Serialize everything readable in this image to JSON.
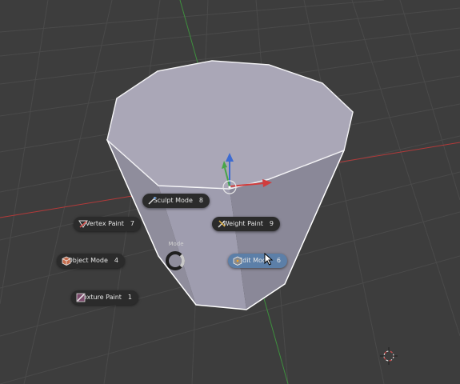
{
  "viewport": {
    "background_color": "#3d3d3d",
    "grid_color": "#4a4a4a",
    "x_axis_color": "#b23a3a",
    "y_axis_color": "#3e8f3e"
  },
  "object": {
    "name": "cylinder",
    "face_color": "#a8a4b2",
    "outline_color": "#ffffff",
    "side_color_light": "#9896a6",
    "side_color_dark": "#7c7b8a"
  },
  "pie_menu": {
    "center_label": "Mode",
    "items": [
      {
        "id": "sculpt",
        "label": "Sculpt Mode",
        "shortcut": "8",
        "icon": "sculpt-brush-icon",
        "active": false
      },
      {
        "id": "vertex-paint",
        "label": "Vertex Paint",
        "shortcut": "7",
        "icon": "vertex-paint-icon",
        "active": false
      },
      {
        "id": "weight-paint",
        "label": "Weight Paint",
        "shortcut": "9",
        "icon": "weight-paint-icon",
        "active": false
      },
      {
        "id": "object",
        "label": "Object Mode",
        "shortcut": "4",
        "icon": "object-cube-icon",
        "active": false
      },
      {
        "id": "edit",
        "label": "Edit Mode",
        "shortcut": "6",
        "icon": "edit-mesh-icon",
        "active": true
      },
      {
        "id": "texture-paint",
        "label": "Texture Paint",
        "shortcut": "1",
        "icon": "texture-paint-icon",
        "active": false
      }
    ]
  },
  "colors": {
    "pill_bg": "#2b2b2b",
    "pill_active_bg": "#5c7fa8",
    "text": "#e6e6e6"
  },
  "icons": {
    "gizmo_z": "gizmo-z-arrow-icon",
    "gizmo_x": "gizmo-x-arrow-icon",
    "gizmo_y": "gizmo-y-arrow-icon",
    "cursor_3d": "3d-cursor-icon",
    "pointer": "mouse-pointer-icon"
  }
}
